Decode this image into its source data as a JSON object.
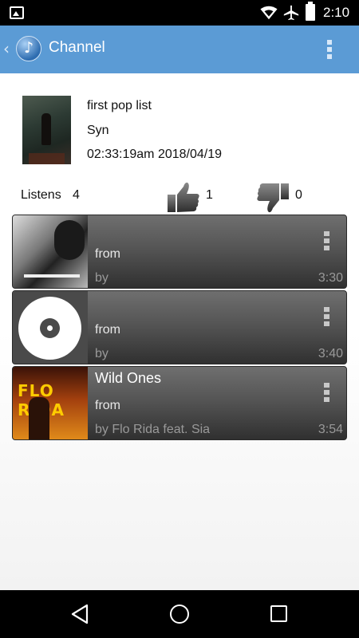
{
  "status_bar": {
    "time": "2:10",
    "icons": [
      "image-icon",
      "wifi-icon",
      "airplane-icon",
      "battery-icon"
    ]
  },
  "app_bar": {
    "title": "Channel",
    "back_icon": "‹",
    "logo_glyph": "♪",
    "menu_icon": "overflow-menu-icon"
  },
  "playlist": {
    "name": "first pop list",
    "owner": "Syn",
    "created": "02:33:19am 2018/04/19"
  },
  "stats": {
    "listens_label": "Listens",
    "listens_count": "4",
    "likes": "1",
    "dislikes": "0"
  },
  "songs": [
    {
      "title": "",
      "from": "from",
      "by": "by",
      "duration": "3:30"
    },
    {
      "title": "",
      "from": "from",
      "by": "by",
      "duration": "3:40"
    },
    {
      "title": "Wild Ones",
      "from": "from",
      "by": "by Flo Rida feat. Sia",
      "duration": "3:54",
      "art_text": "FLO RIDA"
    }
  ],
  "colors": {
    "app_bar": "#5b9bd5",
    "song_card_top": "#6f6f6f",
    "song_card_bottom": "#303030"
  }
}
